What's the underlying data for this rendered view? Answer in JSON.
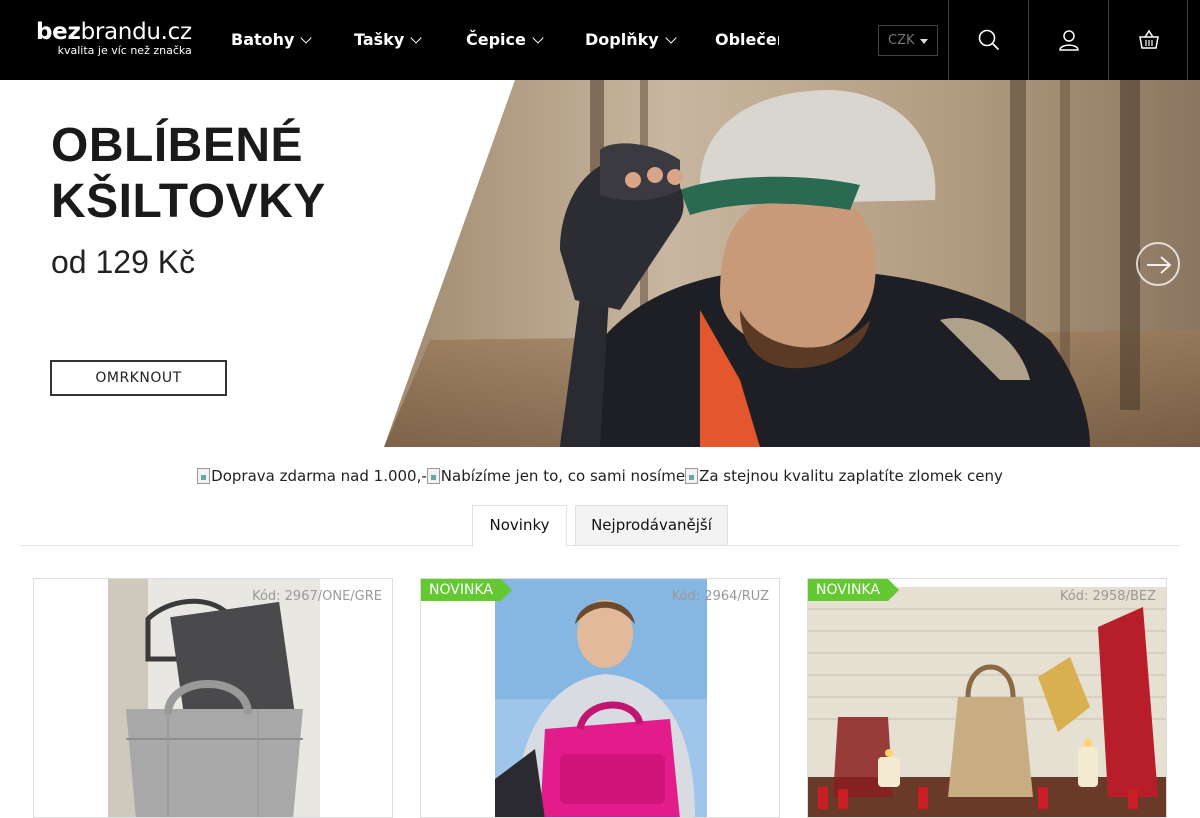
{
  "header": {
    "logo": {
      "bold": "bez",
      "rest": "brandu.cz",
      "tagline": "kvalita je víc než značka"
    },
    "nav": [
      {
        "label": "Batohy"
      },
      {
        "label": "Tašky"
      },
      {
        "label": "Čepice"
      },
      {
        "label": "Doplňky"
      },
      {
        "label": "Oblečení"
      }
    ],
    "currency": "CZK",
    "icons": [
      "search-icon",
      "user-icon",
      "basket-icon"
    ]
  },
  "hero": {
    "title_line1": "OBLÍBENÉ",
    "title_line2": "KŠILTOVKY",
    "subtitle": "od 129 Kč",
    "cta": "OMRKNOUT"
  },
  "benefits": [
    "Doprava zdarma nad 1.000,-",
    "Nabízíme jen to, co sami nosíme",
    "Za stejnou kvalitu zaplatíte zlomek ceny"
  ],
  "tabs": [
    {
      "label": "Novinky",
      "active": true
    },
    {
      "label": "Nejprodávanější",
      "active": false
    }
  ],
  "products": [
    {
      "badge": "",
      "code": "Kód: 2967/ONE/GRE"
    },
    {
      "badge": "NOVINKA",
      "code": "Kód: 2964/RUZ"
    },
    {
      "badge": "NOVINKA",
      "code": "Kód: 2958/BEZ"
    }
  ],
  "colors": {
    "header_bg": "#000000",
    "badge_green": "#64c832"
  }
}
